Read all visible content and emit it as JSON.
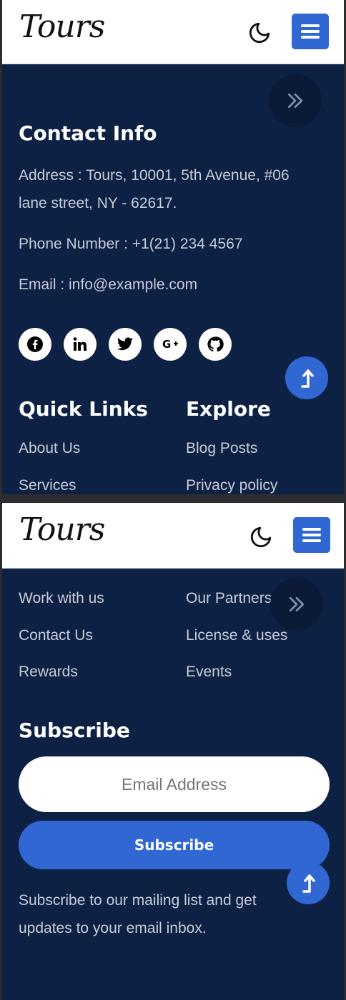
{
  "brand": "Tours",
  "contact": {
    "heading": "Contact Info",
    "address": "Address : Tours, 10001, 5th Avenue, #06 lane street, NY - 62617.",
    "phone": "Phone Number : +1(21) 234 4567",
    "email": "Email : info@example.com"
  },
  "social": [
    "facebook-icon",
    "linkedin-icon",
    "twitter-icon",
    "google-plus-icon",
    "github-icon"
  ],
  "quick_links": {
    "heading": "Quick Links",
    "items": [
      "About Us",
      "Services",
      "Work with us",
      "Contact Us",
      "Rewards"
    ]
  },
  "explore": {
    "heading": "Explore",
    "items": [
      "Blog Posts",
      "Privacy policy",
      "Our Partners",
      "License & uses",
      "Events"
    ]
  },
  "subscribe": {
    "heading": "Subscribe",
    "placeholder": "Email Address",
    "button": "Subscribe",
    "note": "Subscribe to our mailing list and get updates to your email inbox."
  },
  "colors": {
    "footer_bg": "#0d2145",
    "accent": "#3067d2",
    "text_muted": "#c8ccd6"
  }
}
